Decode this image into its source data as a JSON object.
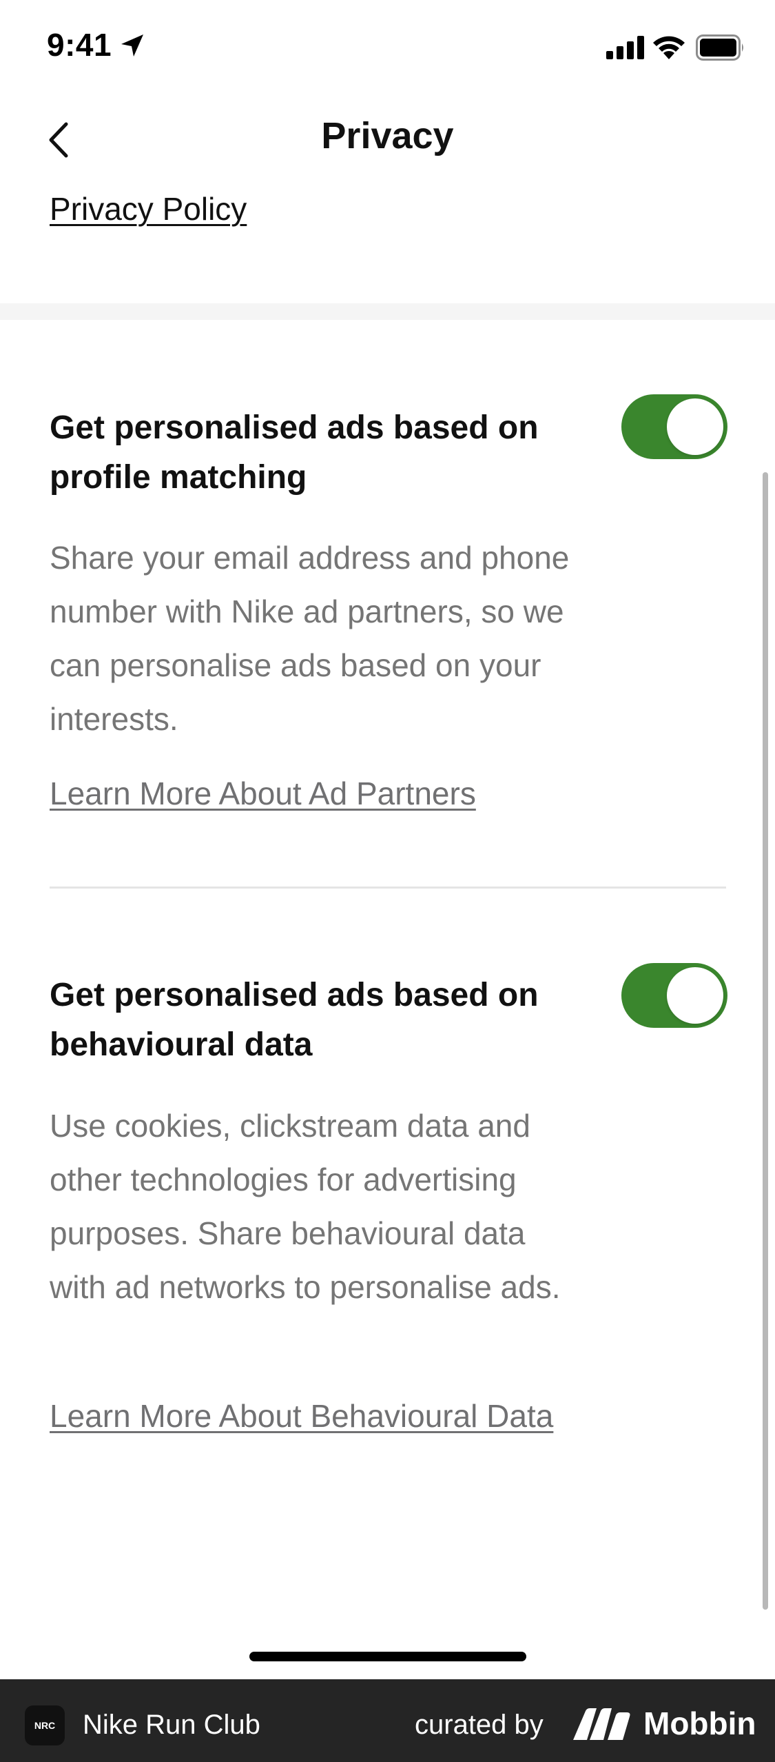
{
  "status_bar": {
    "time": "9:41"
  },
  "nav": {
    "title": "Privacy"
  },
  "privacy_policy_link": "Privacy Policy",
  "settings": [
    {
      "title": "Get personalised ads based on profile matching",
      "description": "Share your email address and phone number with Nike ad partners, so we can personalise ads based on your interests.",
      "link": "Learn More About Ad Partners",
      "enabled": true
    },
    {
      "title": "Get personalised ads based on behavioural data",
      "description": "Use cookies, clickstream data and other technologies for advertising purposes. Share behavioural data with ad networks to personalise ads.",
      "link": "Learn More About Behavioural Data",
      "enabled": true
    }
  ],
  "colors": {
    "toggle_on": "#3a862d",
    "footer_bg": "#252525"
  },
  "footer": {
    "app_icon_text": "NRC",
    "app_name": "Nike Run Club",
    "curated_by": "curated by",
    "brand": "Mobbin"
  }
}
